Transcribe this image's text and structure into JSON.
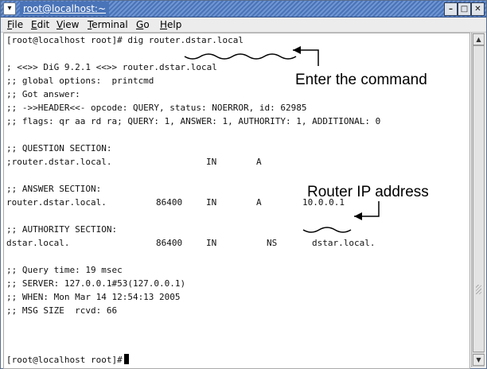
{
  "window": {
    "title": "root@localhost:~",
    "controls": [
      "minimize-icon",
      "maximize-icon",
      "close-icon"
    ],
    "title_bar_color": "#4a74b8"
  },
  "menubar": {
    "items": [
      "File",
      "Edit",
      "View",
      "Terminal",
      "Go",
      "Help"
    ]
  },
  "terminal": {
    "command_line": "[root@localhost root]# dig router.dstar.local",
    "lines": [
      "; <<>> DiG 9.2.1 <<>> router.dstar.local",
      ";; global options:  printcmd",
      ";; Got answer:",
      ";; ->>HEADER<<- opcode: QUERY, status: NOERROR, id: 62985",
      ";; flags: qr aa rd ra; QUERY: 1, ANSWER: 1, AUTHORITY: 1, ADDITIONAL: 0",
      ";; QUESTION SECTION:",
      ";router.dstar.local.",
      ";; ANSWER SECTION:",
      "router.dstar.local.",
      ";; AUTHORITY SECTION:",
      "dstar.local.",
      ";; Query time: 19 msec",
      ";; SERVER: 127.0.0.1#53(127.0.0.1)",
      ";; WHEN: Mon Mar 14 12:54:13 2005",
      ";; MSG SIZE  rcvd: 66"
    ],
    "question_record": {
      "class": "IN",
      "type": "A"
    },
    "answer_record": {
      "ttl": "86400",
      "class": "IN",
      "type": "A",
      "data": "10.0.0.1"
    },
    "authority_record": {
      "ttl": "86400",
      "class": "IN",
      "type": "NS",
      "data": "dstar.local."
    },
    "prompt": "[root@localhost root]#"
  },
  "annotations": {
    "command_label": "Enter the command",
    "ip_label": "Router IP address"
  }
}
